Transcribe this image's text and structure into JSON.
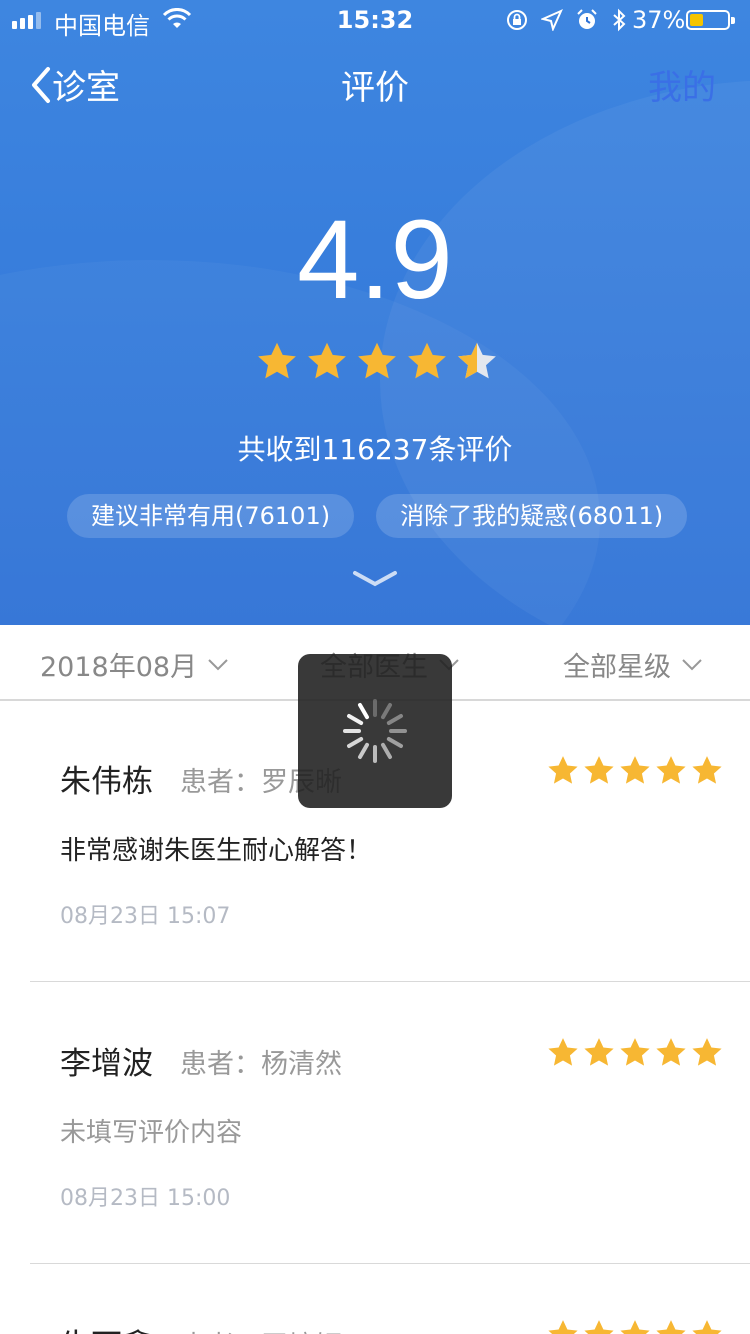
{
  "status_bar": {
    "carrier": "中国电信",
    "time": "15:32",
    "battery_percent": "37%",
    "battery_level": 0.37,
    "battery_color": "#f5c400",
    "icons": [
      "signal-icon",
      "wifi-icon",
      "rotation-lock-icon",
      "location-icon",
      "alarm-icon",
      "bluetooth-icon",
      "battery-icon"
    ]
  },
  "nav": {
    "back_label": "诊室",
    "title": "评价",
    "right_label": "我的"
  },
  "summary": {
    "score": "4.9",
    "star_rating": 4.5,
    "count_text": "共收到116237条评价",
    "tags": [
      {
        "label": "建议非常有用(76101)"
      },
      {
        "label": "消除了我的疑惑(68011)"
      }
    ]
  },
  "filters": {
    "month": "2018年08月",
    "doctor": "全部医生",
    "rating": "全部星级"
  },
  "reviews": [
    {
      "doctor": "朱伟栋",
      "patient": "患者：罗辰晰",
      "stars": 5,
      "content": "非常感谢朱医生耐心解答！",
      "date": "08月23日 15:07"
    },
    {
      "doctor": "李增波",
      "patient": "患者：杨清然",
      "stars": 5,
      "content": "未填写评价内容",
      "date": "08月23日 15:00"
    },
    {
      "doctor": "牛可鑫",
      "patient": "患者：王培妍",
      "stars": 5
    }
  ],
  "colors": {
    "header_blue": "#2f72d6",
    "star_gold": "#f7b733",
    "nav_right": "#3a6fe6"
  }
}
